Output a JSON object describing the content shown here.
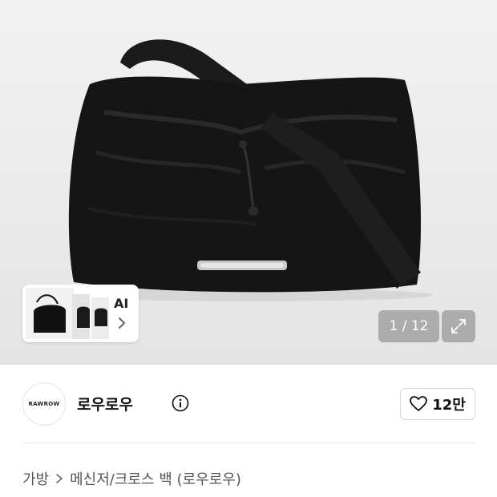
{
  "gallery": {
    "counter": "1 / 12",
    "ai_label": "AI"
  },
  "brand": {
    "logo_text": "RAWROW",
    "name": "로우로우",
    "likes": "12만"
  },
  "breadcrumb": {
    "category": "가방",
    "subcategory": "메신저/크로스 백 (로우로우)"
  }
}
